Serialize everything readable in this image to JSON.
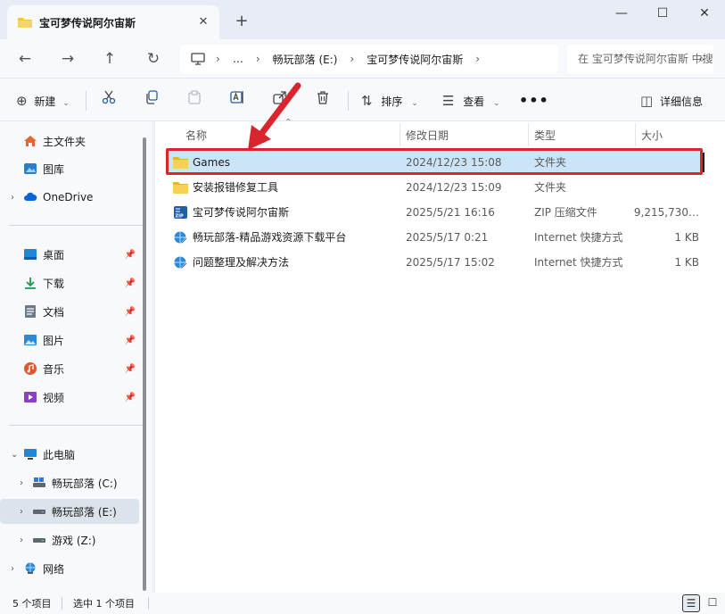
{
  "window": {
    "tab_title": "宝可梦传说阿尔宙斯",
    "tab_close": "✕",
    "new_tab": "+",
    "minimize": "—",
    "maximize": "☐",
    "close": "✕"
  },
  "nav": {
    "back": "←",
    "forward": "→",
    "up": "↑",
    "refresh": "↻",
    "breadcrumb": [
      "…",
      "畅玩部落 (E:)",
      "宝可梦传说阿尔宙斯"
    ],
    "search_placeholder": "在 宝可梦传说阿尔宙斯 中搜索"
  },
  "toolbar": {
    "new_label": "新建",
    "sort_label": "排序",
    "view_label": "查看",
    "more_label": "•••",
    "details_label": "详细信息"
  },
  "sidebar": {
    "quick": [
      {
        "label": "主文件夹",
        "icon": "home-icon"
      },
      {
        "label": "图库",
        "icon": "gallery-icon"
      },
      {
        "label": "OneDrive",
        "icon": "cloud-icon"
      }
    ],
    "pinned": [
      {
        "label": "桌面",
        "icon": "desktop-icon"
      },
      {
        "label": "下载",
        "icon": "download-icon"
      },
      {
        "label": "文档",
        "icon": "document-icon"
      },
      {
        "label": "图片",
        "icon": "picture-icon"
      },
      {
        "label": "音乐",
        "icon": "music-icon"
      },
      {
        "label": "视频",
        "icon": "video-icon"
      }
    ],
    "this_pc": "此电脑",
    "drives": [
      {
        "label": "畅玩部落 (C:)",
        "icon": "drive-icon"
      },
      {
        "label": "畅玩部落 (E:)",
        "icon": "drive-icon",
        "selected": true
      },
      {
        "label": "游戏 (Z:)",
        "icon": "drive-icon"
      }
    ],
    "network": "网络"
  },
  "columns": {
    "name": "名称",
    "modified": "修改日期",
    "type": "类型",
    "size": "大小"
  },
  "files": [
    {
      "name": "Games",
      "modified": "2024/12/23 15:08",
      "type": "文件夹",
      "size": "",
      "icon": "folder-icon",
      "selected": true
    },
    {
      "name": "安装报错修复工具",
      "modified": "2024/12/23 15:09",
      "type": "文件夹",
      "size": "",
      "icon": "folder-icon"
    },
    {
      "name": "宝可梦传说阿尔宙斯",
      "modified": "2025/5/21 16:16",
      "type": "ZIP 压缩文件",
      "size": "9,215,730…",
      "icon": "zip-icon"
    },
    {
      "name": "畅玩部落-精品游戏资源下载平台",
      "modified": "2025/5/17 0:21",
      "type": "Internet 快捷方式",
      "size": "1 KB",
      "icon": "internet-shortcut-icon"
    },
    {
      "name": "问题整理及解决方法",
      "modified": "2025/5/17 15:02",
      "type": "Internet 快捷方式",
      "size": "1 KB",
      "icon": "internet-shortcut-icon"
    }
  ],
  "status": {
    "item_count": "5 个项目",
    "selected_count": "选中 1 个项目"
  },
  "colors": {
    "accent": "#0067c0",
    "selection": "#cce4f7",
    "annotation_red": "#d9262e",
    "folder": "#f4c542"
  }
}
